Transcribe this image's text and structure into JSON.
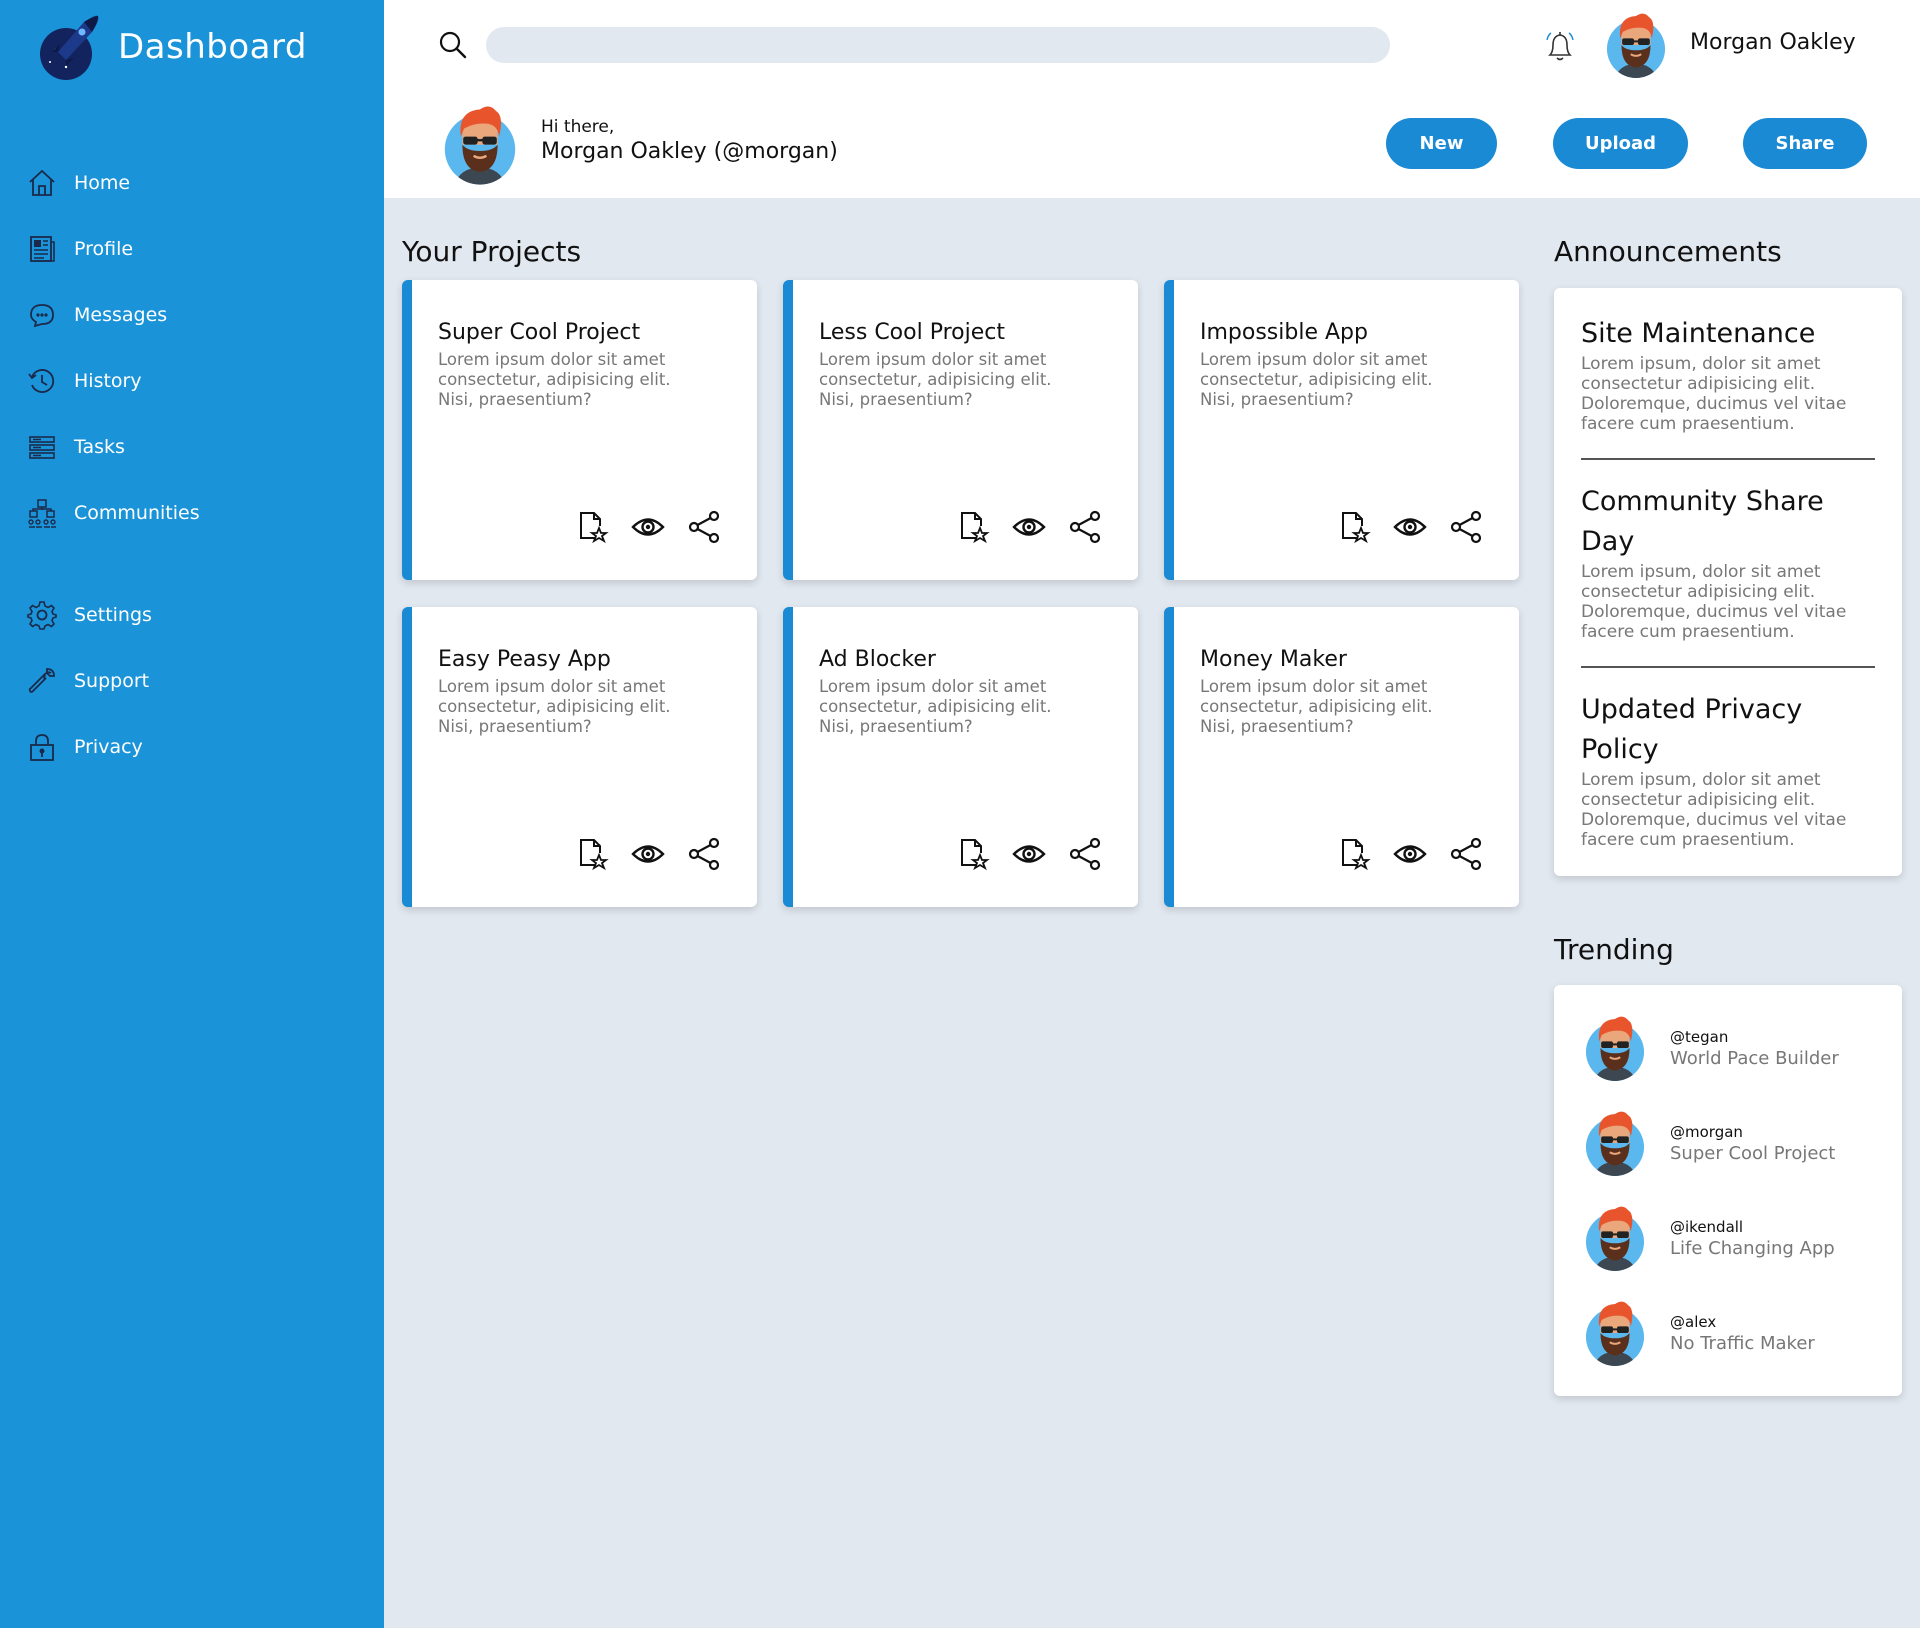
{
  "brand": {
    "title": "Dashboard",
    "logo": "rocket-moon-logo"
  },
  "sidebar": {
    "items": [
      {
        "label": "Home",
        "icon": "home-icon"
      },
      {
        "label": "Profile",
        "icon": "profile-icon"
      },
      {
        "label": "Messages",
        "icon": "messages-icon"
      },
      {
        "label": "History",
        "icon": "history-icon"
      },
      {
        "label": "Tasks",
        "icon": "tasks-icon"
      },
      {
        "label": "Communities",
        "icon": "communities-icon"
      },
      {
        "label": "Settings",
        "icon": "gear-icon"
      },
      {
        "label": "Support",
        "icon": "wrench-icon"
      },
      {
        "label": "Privacy",
        "icon": "lock-icon"
      }
    ]
  },
  "header": {
    "search_placeholder": "",
    "user_name": "Morgan Oakley",
    "greeting": "Hi there,",
    "greeting_name": "Morgan Oakley (@morgan)",
    "buttons": {
      "new": "New",
      "upload": "Upload",
      "share": "Share"
    }
  },
  "projects": {
    "title": "Your Projects",
    "cards": [
      {
        "title": "Super Cool Project",
        "desc": "Lorem ipsum dolor sit amet consectetur, adipisicing elit. Nisi, praesentium?"
      },
      {
        "title": "Less Cool Project",
        "desc": "Lorem ipsum dolor sit amet consectetur, adipisicing elit. Nisi, praesentium?"
      },
      {
        "title": "Impossible App",
        "desc": "Lorem ipsum dolor sit amet consectetur, adipisicing elit. Nisi, praesentium?"
      },
      {
        "title": "Easy Peasy App",
        "desc": "Lorem ipsum dolor sit amet consectetur, adipisicing elit. Nisi, praesentium?"
      },
      {
        "title": "Ad Blocker",
        "desc": "Lorem ipsum dolor sit amet consectetur, adipisicing elit. Nisi, praesentium?"
      },
      {
        "title": "Money Maker",
        "desc": "Lorem ipsum dolor sit amet consectetur, adipisicing elit. Nisi, praesentium?"
      }
    ]
  },
  "announcements": {
    "title": "Announcements",
    "items": [
      {
        "title": "Site Maintenance",
        "body": "Lorem ipsum, dolor sit amet consectetur adipisicing elit. Doloremque, ducimus vel vitae facere cum praesentium."
      },
      {
        "title": "Community Share Day",
        "body": "Lorem ipsum, dolor sit amet consectetur adipisicing elit. Doloremque, ducimus vel vitae facere cum praesentium."
      },
      {
        "title": "Updated Privacy Policy",
        "body": "Lorem ipsum, dolor sit amet consectetur adipisicing elit. Doloremque, ducimus vel vitae facere cum praesentium."
      }
    ]
  },
  "trending": {
    "title": "Trending",
    "items": [
      {
        "handle": "@tegan",
        "project": "World Pace Builder"
      },
      {
        "handle": "@morgan",
        "project": "Super Cool Project"
      },
      {
        "handle": "@ikendall",
        "project": "Life Changing App"
      },
      {
        "handle": "@alex",
        "project": "No Traffic Maker"
      }
    ]
  },
  "colors": {
    "sidebar": "#1a93d8",
    "accent": "#1a8ad4",
    "background": "#e2e8f0",
    "muted_text": "#777777"
  }
}
